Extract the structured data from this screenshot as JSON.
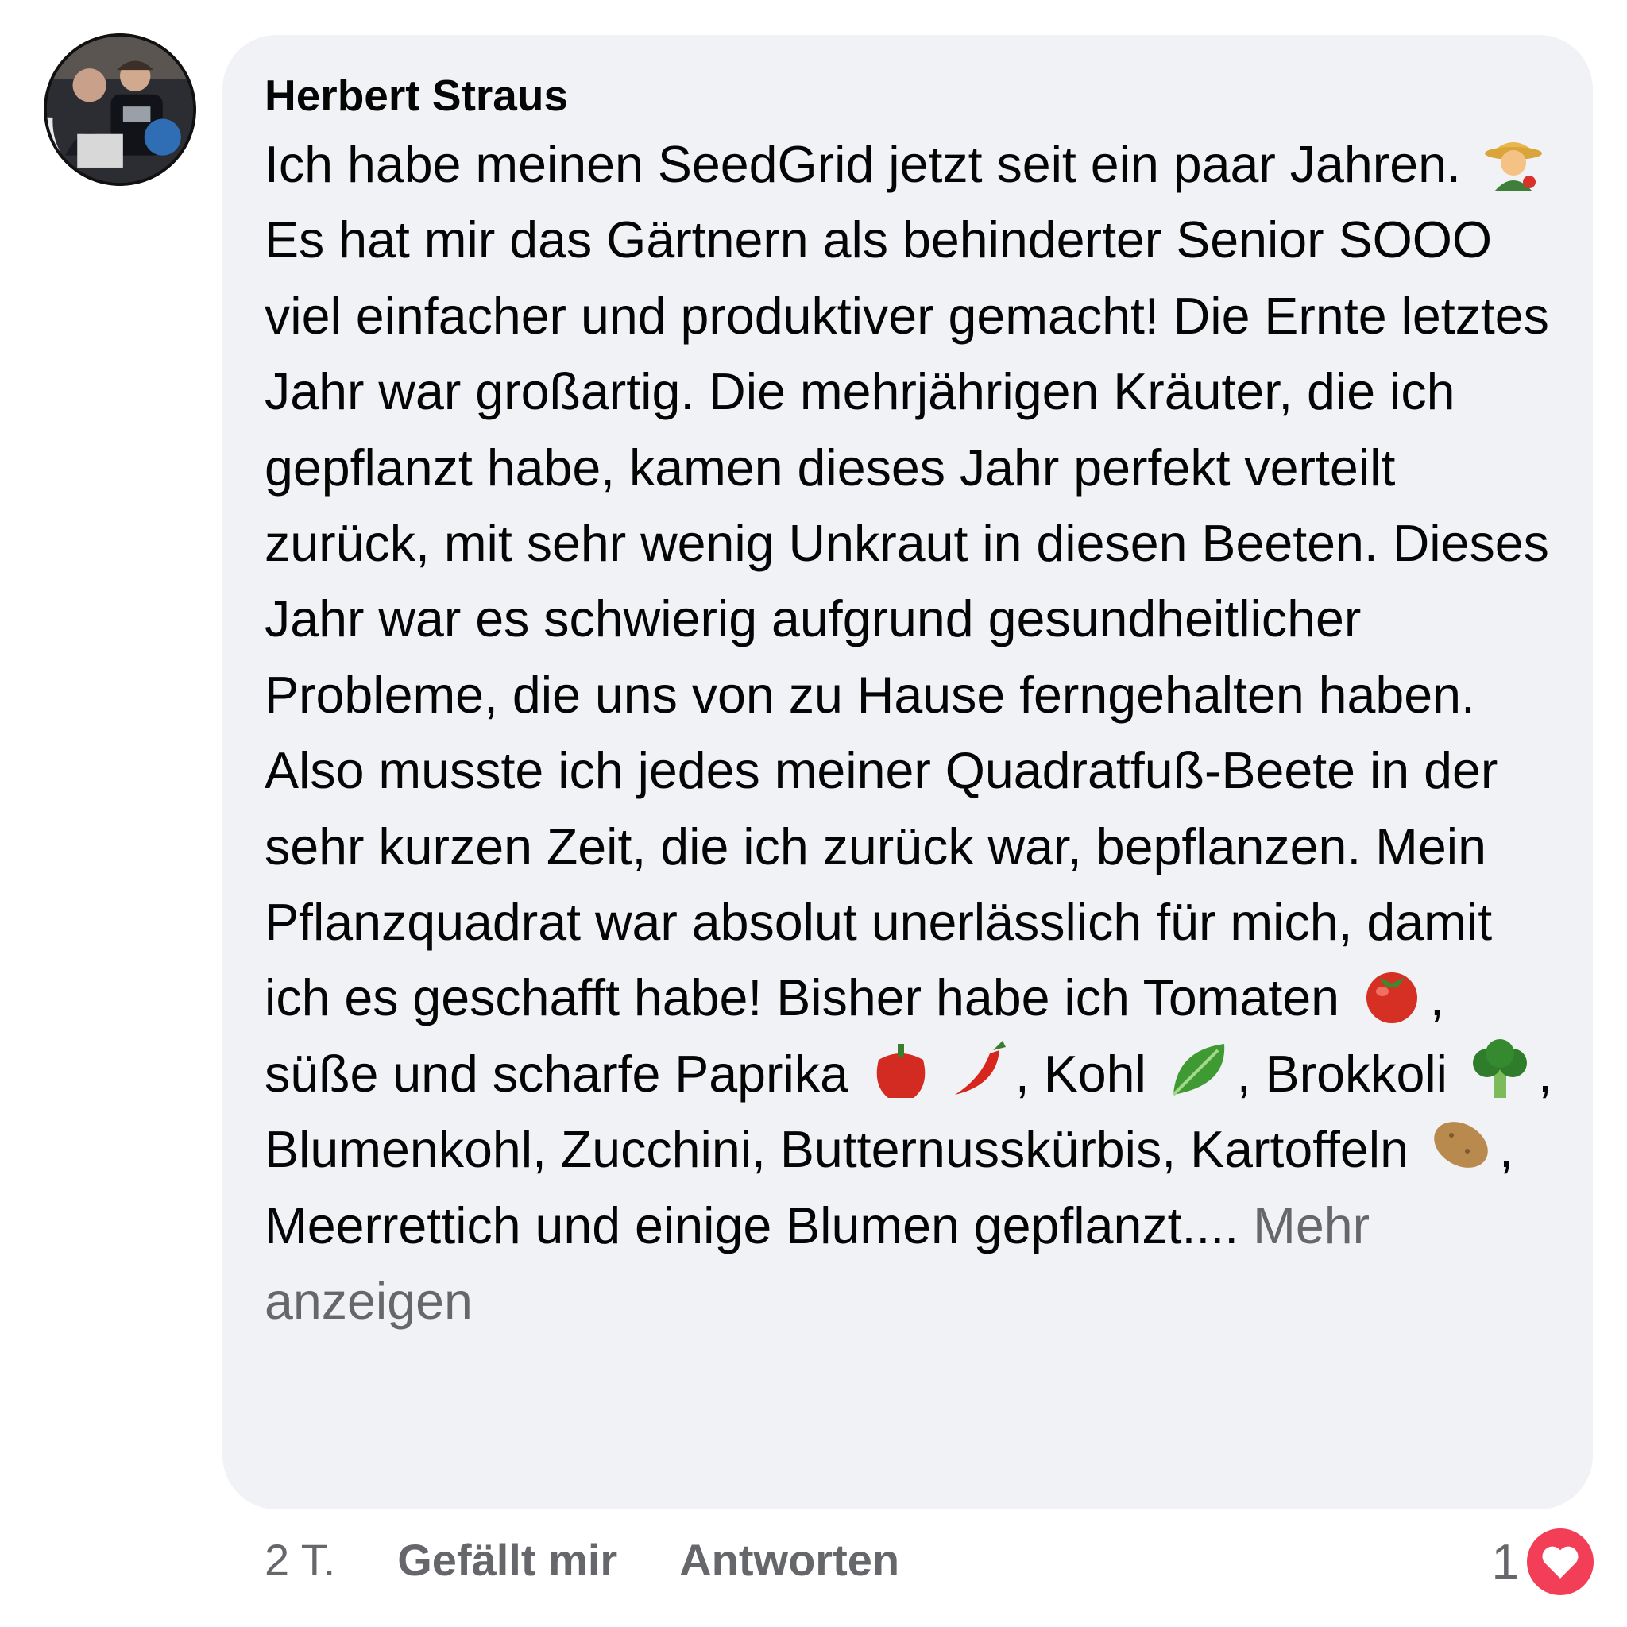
{
  "comment": {
    "author": "Herbert Straus",
    "segments": {
      "s1": "Ich habe meinen SeedGrid jetzt seit ein paar Jahren.",
      "s2": "Es hat mir das Gärtnern als behinderter Senior SOOO viel einfacher und produktiver gemacht! Die Ernte letztes Jahr war großartig. Die mehrjährigen Kräuter, die ich gepflanzt habe, kamen dieses Jahr perfekt verteilt zurück, mit sehr wenig Unkraut in diesen Beeten. Dieses Jahr war es schwierig aufgrund gesundheitlicher Probleme, die uns von zu Hause ferngehalten haben. Also musste ich jedes meiner Quadratfuß-Beete in der sehr kurzen Zeit, die ich zurück war, bepflanzen. Mein Pflanzquadrat war absolut unerlässlich für mich, damit ich es geschafft habe! Bisher habe ich Tomaten",
      "s3": ", süße und scharfe Paprika",
      "s4": ", Kohl",
      "s5": ", Brokkoli",
      "s6": ", Blumenkohl, Zucchini, Butternusskürbis, Kartoffeln",
      "s7": ", Meerrettich und einige Blumen gepflanzt...."
    },
    "see_more": "Mehr anzeigen",
    "emojis": [
      "farmer-icon",
      "tomato-icon",
      "bell-pepper-icon",
      "chili-pepper-icon",
      "leafy-green-icon",
      "broccoli-icon",
      "potato-icon"
    ]
  },
  "actions": {
    "timestamp": "2 T.",
    "like": "Gefällt mir",
    "reply": "Antworten"
  },
  "reactions": {
    "count": "1",
    "type": "heart-icon",
    "color": "#f33e58"
  },
  "colors": {
    "bubble": "#f0f2f5",
    "text": "#050505",
    "secondary": "#65676b"
  }
}
